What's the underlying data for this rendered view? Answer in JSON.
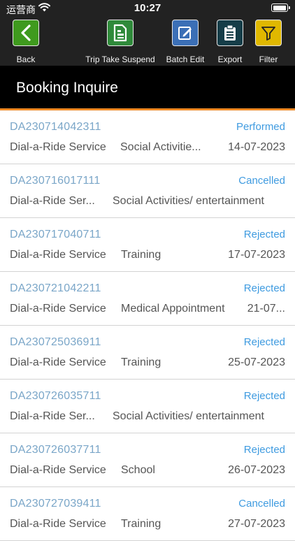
{
  "status_bar": {
    "carrier": "运营商",
    "time": "10:27"
  },
  "toolbar": {
    "back": "Back",
    "trip_take_suspend": "Trip Take Suspend",
    "batch_edit": "Batch Edit",
    "export": "Export",
    "filter": "Filter"
  },
  "colors": {
    "back": "#3f9a1e",
    "trip_take_suspend": "#2f8a3a",
    "batch_edit": "#3b6fb6",
    "export": "#153d48",
    "filter": "#e0b800",
    "accent_line": "#f08a24",
    "status_text": "#3f9be0"
  },
  "page": {
    "title": "Booking Inquire"
  },
  "bookings": [
    {
      "id": "DA230714042311",
      "status": "Performed",
      "service": "Dial-a-Ride Service",
      "purpose": "Social Activitie...",
      "date": "14-07-2023"
    },
    {
      "id": "DA230716017111",
      "status": "Cancelled",
      "service": "Dial-a-Ride Ser...",
      "purpose": "Social Activities/ entertainment",
      "date": ""
    },
    {
      "id": "DA230717040711",
      "status": "Rejected",
      "service": "Dial-a-Ride Service",
      "purpose": "Training",
      "date": "17-07-2023"
    },
    {
      "id": "DA230721042211",
      "status": "Rejected",
      "service": "Dial-a-Ride Service",
      "purpose": "Medical Appointment",
      "date": "21-07..."
    },
    {
      "id": "DA230725036911",
      "status": "Rejected",
      "service": "Dial-a-Ride Service",
      "purpose": "Training",
      "date": "25-07-2023"
    },
    {
      "id": "DA230726035711",
      "status": "Rejected",
      "service": "Dial-a-Ride Ser...",
      "purpose": "Social Activities/ entertainment",
      "date": ""
    },
    {
      "id": "DA230726037711",
      "status": "Rejected",
      "service": "Dial-a-Ride Service",
      "purpose": "School",
      "date": "26-07-2023"
    },
    {
      "id": "DA230727039411",
      "status": "Cancelled",
      "service": "Dial-a-Ride Service",
      "purpose": "Training",
      "date": "27-07-2023"
    }
  ]
}
